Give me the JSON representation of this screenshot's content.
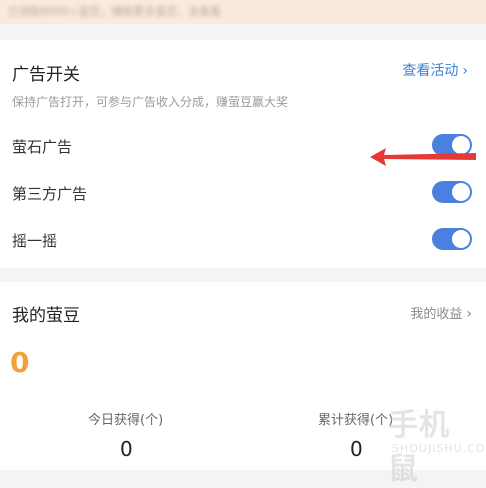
{
  "banner": {
    "blurred_text": "已领取8000+蓝豆，赚取更多蓝豆，去看看"
  },
  "ads_section": {
    "title": "广告开关",
    "link_label": "查看活动",
    "subtitle": "保持广告打开，可参与广告收入分成，赚萤豆赢大奖",
    "rows": [
      {
        "label": "萤石广告",
        "enabled": true
      },
      {
        "label": "第三方广告",
        "enabled": true
      },
      {
        "label": "摇一摇",
        "enabled": true
      }
    ]
  },
  "beans_section": {
    "title": "我的萤豆",
    "link_label": "我的收益",
    "balance": "0",
    "stats": [
      {
        "label": "今日获得(个)",
        "value": "0"
      },
      {
        "label": "累计获得(个)",
        "value": "0"
      }
    ]
  },
  "watermark": {
    "text": "手机鼠",
    "url": "SHOUJISHU.COM"
  },
  "colors": {
    "toggle_on": "#4a80df",
    "link_blue": "#3d7fd9",
    "balance_orange": "#f2a03c",
    "arrow_red": "#e53935"
  },
  "icons": {
    "chevron": "chevron-right-icon",
    "arrow": "red-arrow-icon"
  }
}
